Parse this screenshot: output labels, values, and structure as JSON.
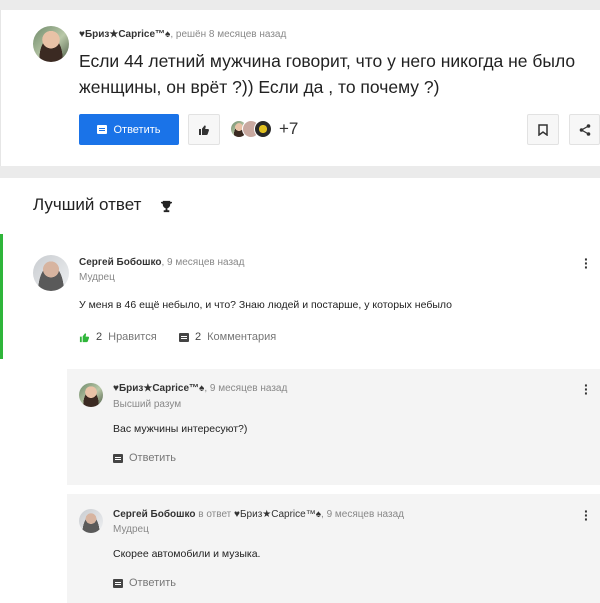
{
  "question": {
    "author": "♥Бриз★Caprice™♠",
    "status": "решён 8 месяцев назад",
    "title": "Если 44 летний мужчина говорит, что у него никогда не было женщины, он врёт ?)) Если да , то почему ?)",
    "answer_button": "Ответить",
    "like_icon": "thumbs-up-icon",
    "followers_more": "+7",
    "bookmark_icon": "bookmark-icon",
    "share_icon": "share-icon"
  },
  "best_answer": {
    "heading": "Лучший ответ",
    "trophy_icon": "trophy-icon",
    "author": "Сергей Бобошко",
    "time": "9 месяцев назад",
    "rank": "Мудрец",
    "text": "У меня в 46 ещё небыло, и что? Знаю людей и постарше, у которых небыло",
    "likes_count": "2",
    "likes_label": "Нравится",
    "comments_count": "2",
    "comments_label": "Комментария",
    "accent_color": "#2fb53a"
  },
  "comments": [
    {
      "author": "♥Бриз★Caprice™♠",
      "time": "9 месяцев назад",
      "rank": "Высший разум",
      "text": "Вас мужчины интересуют?)",
      "reply_label": "Ответить"
    },
    {
      "author": "Сергей Бобошко",
      "reply_to_prefix": "в ответ",
      "reply_to": "♥Бриз★Caprice™♠",
      "time": "9 месяцев назад",
      "rank": "Мудрец",
      "text": "Скорее автомобили и музыка.",
      "reply_label": "Ответить"
    }
  ]
}
